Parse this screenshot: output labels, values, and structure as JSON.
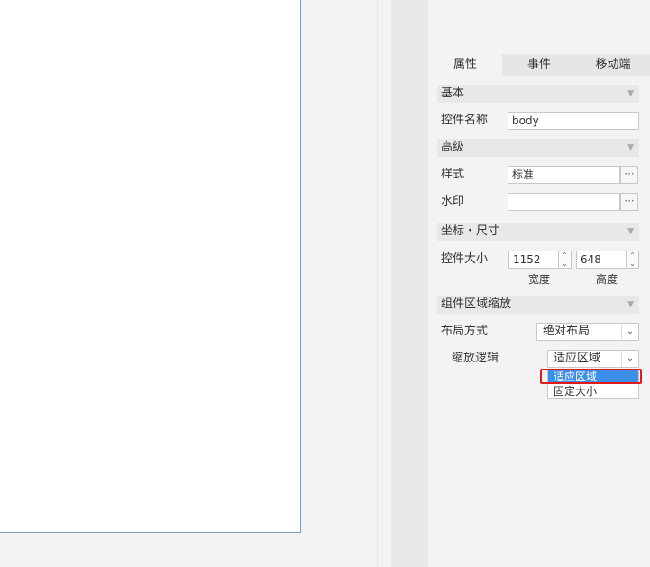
{
  "tabs": [
    "属性",
    "事件",
    "移动端"
  ],
  "sections": {
    "basic": "基本",
    "advanced": "高级",
    "coords": "坐标・尺寸",
    "scaling": "组件区域缩放"
  },
  "basic": {
    "name_label": "控件名称",
    "name_value": "body"
  },
  "advanced": {
    "style_label": "样式",
    "style_value": "标准",
    "watermark_label": "水印",
    "watermark_value": "",
    "more_glyph": "···"
  },
  "size": {
    "label": "控件大小",
    "width": "1152",
    "height": "648",
    "width_label": "宽度",
    "height_label": "高度"
  },
  "scaling": {
    "layout_label": "布局方式",
    "layout_value": "绝对布局",
    "logic_label": "缩放逻辑",
    "logic_value": "适应区域",
    "options": [
      "适应区域",
      "固定大小"
    ]
  },
  "icons": {
    "section_caret": "caret-down-icon",
    "spin": "spin-arrows-icon",
    "select": "chevron-down-icon"
  },
  "colors": {
    "selected": "#3c8fe8",
    "highlight": "#e21a1a",
    "page_border": "#7a9cc6"
  }
}
